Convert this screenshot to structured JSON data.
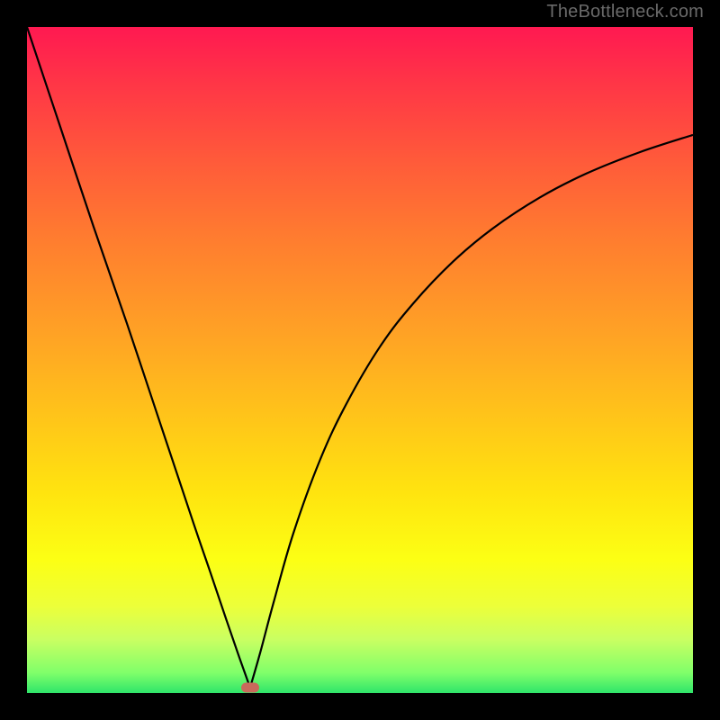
{
  "attribution": "TheBottleneck.com",
  "chart_data": {
    "type": "line",
    "title": "",
    "xlabel": "",
    "ylabel": "",
    "xlim": [
      0,
      100
    ],
    "ylim": [
      0,
      100
    ],
    "series": [
      {
        "name": "left-branch",
        "x": [
          0,
          5,
          10,
          15,
          20,
          25,
          27.5,
          30,
          32,
          33.5
        ],
        "y": [
          100,
          85,
          70,
          55.5,
          40.5,
          25.5,
          18.2,
          10.8,
          5,
          0.8
        ]
      },
      {
        "name": "right-branch",
        "x": [
          33.5,
          35,
          37,
          40,
          44,
          48,
          53,
          58,
          64,
          70,
          77,
          84,
          92,
          100
        ],
        "y": [
          0.8,
          6,
          13.5,
          24,
          35,
          43.5,
          52,
          58.5,
          64.8,
          69.8,
          74.4,
          78,
          81.2,
          83.8
        ]
      }
    ],
    "marker": {
      "x": 33.5,
      "y": 0.8,
      "color": "#c96a5b"
    },
    "background_gradient": {
      "top": "#ff1951",
      "mid": "#ffd015",
      "bottom": "#2fe56a"
    }
  }
}
